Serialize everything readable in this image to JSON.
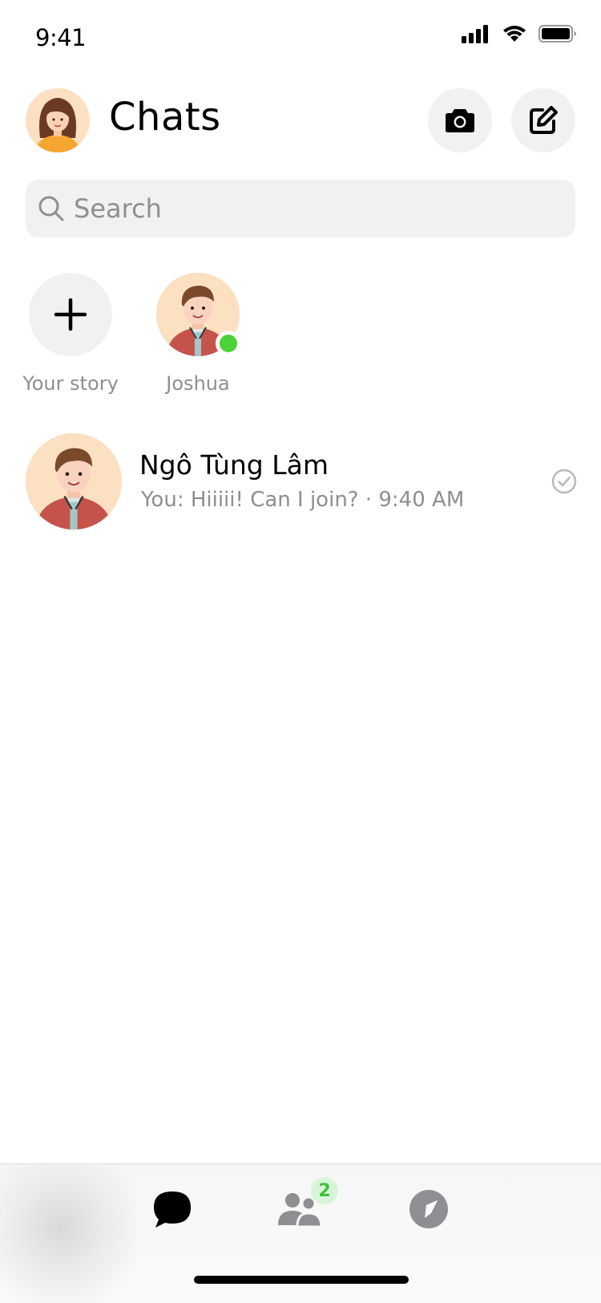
{
  "status_bar": {
    "time": "9:41",
    "icons": [
      "cellular-signal-icon",
      "wifi-icon",
      "battery-icon"
    ]
  },
  "header": {
    "title": "Chats",
    "profile_avatar": "woman-avatar",
    "actions": [
      {
        "icon": "camera-icon"
      },
      {
        "icon": "compose-icon"
      }
    ]
  },
  "search": {
    "placeholder": "Search",
    "value": ""
  },
  "stories": [
    {
      "label": "Your story",
      "icon": "plus-icon"
    },
    {
      "label": "Joshua",
      "online": true
    }
  ],
  "chats": [
    {
      "name": "Ngô Tùng Lâm",
      "preview": "You: Hiiiii! Can I join? · 9:40 AM",
      "status_icon": "read-check-icon"
    }
  ],
  "tab_bar": {
    "tabs": [
      {
        "name": "chats",
        "icon": "chat-bubble-icon",
        "active": true
      },
      {
        "name": "people",
        "icon": "people-icon",
        "badge": "2"
      },
      {
        "name": "discover",
        "icon": "compass-icon"
      }
    ]
  },
  "colors": {
    "online": "#4cd137",
    "secondary_text": "#8e8e93",
    "button_bg": "#f1f1f1",
    "badge_bg": "#d9f5d9",
    "badge_text": "#3cc13b"
  }
}
